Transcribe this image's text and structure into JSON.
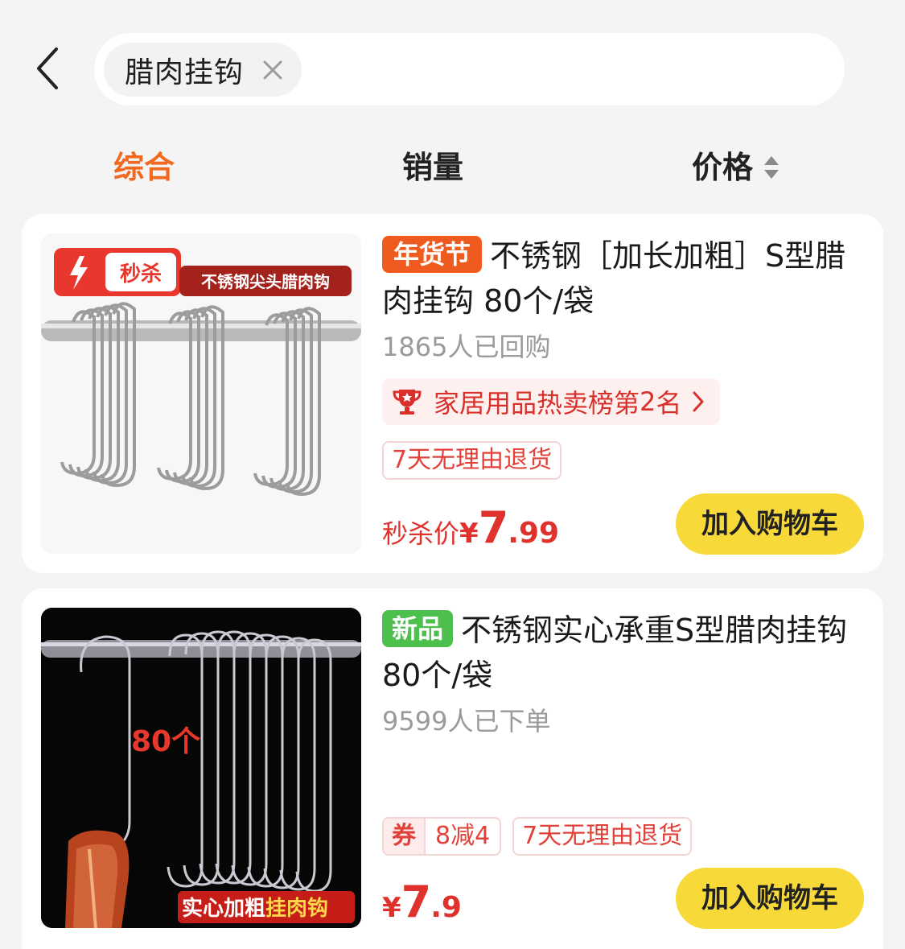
{
  "search": {
    "chip_text": "腊肉挂钩"
  },
  "tabs": [
    {
      "label": "综合",
      "active": true
    },
    {
      "label": "销量",
      "active": false
    },
    {
      "label": "价格",
      "active": false
    }
  ],
  "colors": {
    "accent": "#f26a22",
    "price": "#e0322d",
    "cart_button": "#f8d93a",
    "festival_tag": "#ef5a1f",
    "new_tag": "#4cbf4c"
  },
  "products": [
    {
      "tag": "年货节",
      "title": "不锈钢［加长加粗］S型腊肉挂钩 80个/袋",
      "sales": "1865人已回购",
      "rank": {
        "prefix": "家居用品热卖榜第 ",
        "num": "2",
        "suffix": " 名",
        "icon": "trophy-icon"
      },
      "promos": [
        "7天无理由退货"
      ],
      "price": {
        "label": "秒杀价",
        "currency": "¥",
        "int": "7",
        "dec": ".99"
      },
      "cart_label": "加入购物车",
      "image_texts": {
        "badge": "秒杀",
        "banner": "不锈钢尖头腊肉钩"
      }
    },
    {
      "tag": "新品",
      "title": "不锈钢实心承重S型腊肉挂钩 80个/袋",
      "sales": "9599人已下单",
      "coupon": {
        "key": "券",
        "value": "8减4"
      },
      "promos": [
        "7天无理由退货"
      ],
      "price": {
        "label": "",
        "currency": "¥",
        "int": "7",
        "dec": ".9"
      },
      "cart_label": "加入购物车",
      "image_texts": {
        "count": "80个",
        "banner_a": "实心加粗",
        "banner_b": "挂肉钩"
      }
    }
  ]
}
